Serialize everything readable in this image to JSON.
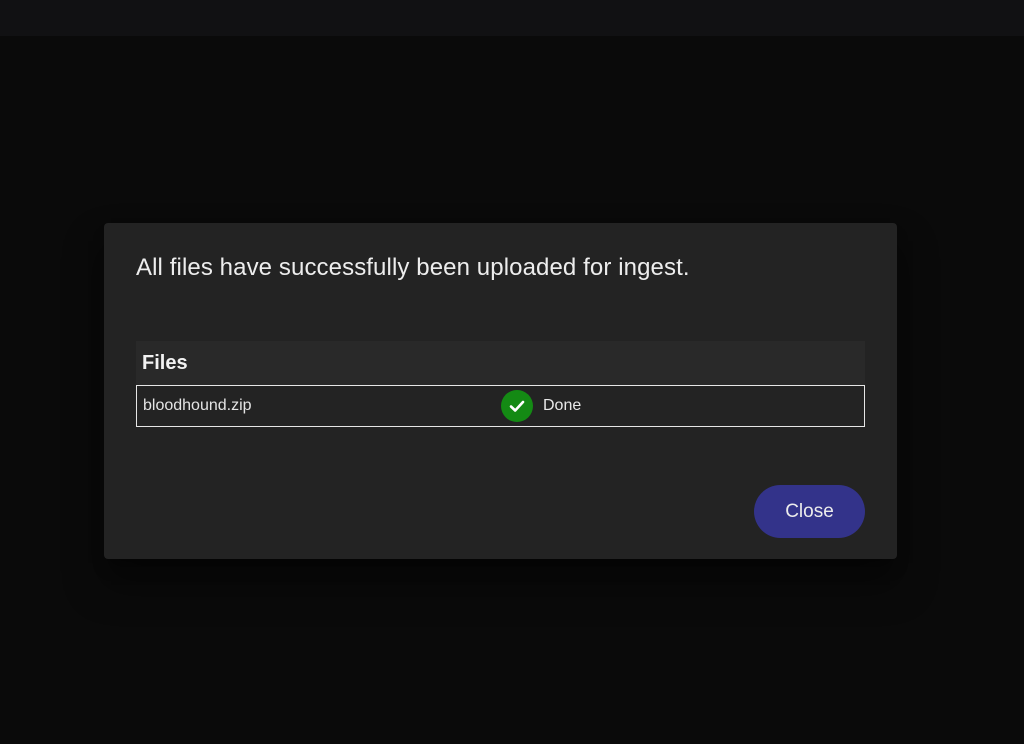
{
  "dialog": {
    "message": "All files have successfully been uploaded for ingest.",
    "table": {
      "header": "Files",
      "rows": [
        {
          "name": "bloodhound.zip",
          "status": "Done",
          "status_icon": "check-circle-icon",
          "status_color": "#148a14"
        }
      ]
    },
    "close_label": "Close",
    "close_color": "#33338a"
  }
}
